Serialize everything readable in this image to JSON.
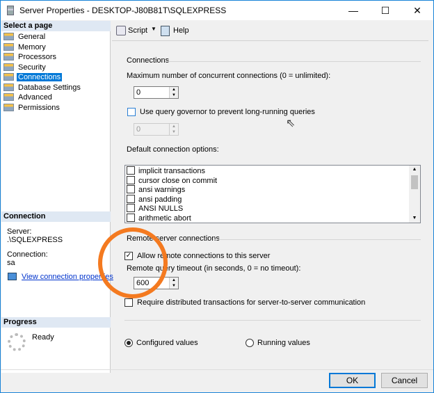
{
  "window": {
    "title": "Server Properties - DESKTOP-J80B81T\\SQLEXPRESS",
    "controls": [
      "—",
      "☐",
      "✕"
    ]
  },
  "left": {
    "select_header": "Select a page",
    "pages": [
      "General",
      "Memory",
      "Processors",
      "Security",
      "Connections",
      "Database Settings",
      "Advanced",
      "Permissions"
    ],
    "selected": "Connections",
    "connection_header": "Connection",
    "server_label": "Server:",
    "server_value": ".\\SQLEXPRESS",
    "connection_label": "Connection:",
    "connection_value": "sa",
    "view_link": "View connection properties",
    "progress_header": "Progress",
    "progress_status": "Ready"
  },
  "toolbar": {
    "script": "Script",
    "help": "Help"
  },
  "connections": {
    "group": "Connections",
    "max_label": "Maximum number of concurrent connections (0 = unlimited):",
    "max_value": "0",
    "governor_label": "Use query governor to prevent long-running queries",
    "governor_checked": false,
    "governor_value": "0",
    "default_label": "Default connection options:",
    "options": [
      "implicit transactions",
      "cursor close on commit",
      "ansi warnings",
      "ansi padding",
      "ANSI NULLS",
      "arithmetic abort"
    ]
  },
  "remote": {
    "group": "Remote server connections",
    "allow_label": "Allow remote connections to this server",
    "allow_checked": true,
    "timeout_label": "Remote query timeout (in seconds, 0 = no timeout):",
    "timeout_value": "600",
    "distributed_label": "Require distributed transactions for server-to-server communication",
    "distributed_checked": false
  },
  "values": {
    "configured": "Configured values",
    "running": "Running values",
    "selected": "configured"
  },
  "buttons": {
    "ok": "OK",
    "cancel": "Cancel"
  },
  "colors": {
    "annotation": "#f47a20",
    "selection": "#0078d7"
  }
}
